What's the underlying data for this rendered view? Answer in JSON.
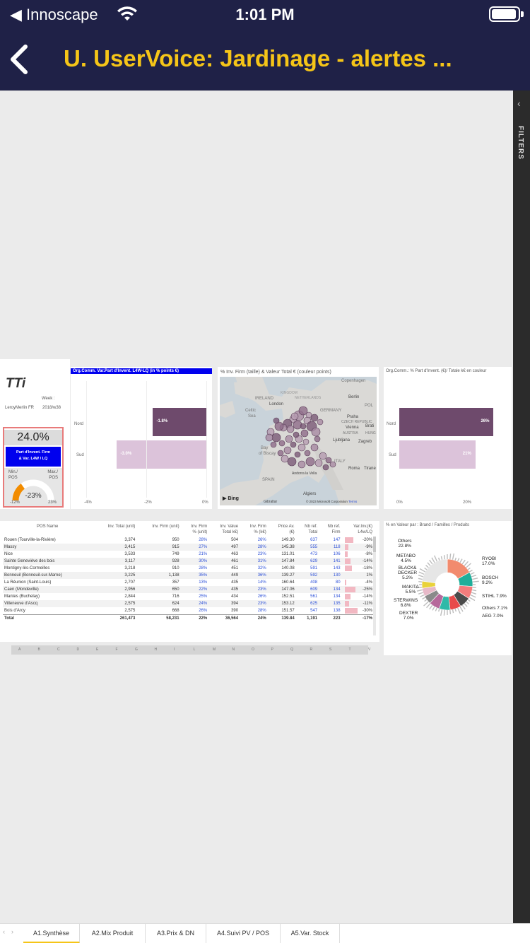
{
  "status": {
    "back_app": "◀ Innoscape",
    "time": "1:01 PM"
  },
  "nav": {
    "title": "U. UserVoice: Jardinage - alertes ..."
  },
  "filters": {
    "label": "FILTERS"
  },
  "logo_card": {
    "logo": "TTi",
    "week_label": "Week :",
    "store": "LeroyMerlin FR",
    "week": "2018/w38"
  },
  "kpi": {
    "value": "24.0%",
    "subtitle_1": "Part d'Invent. Firm",
    "subtitle_2": "& Var. L4W / LQ",
    "min_label": "Min./",
    "min_label2": "POS",
    "max_label": "Max./",
    "max_label2": "POS",
    "gauge_value": "-23%",
    "gauge_min": "-12%",
    "gauge_max": "23%",
    "gauge_fraction": 0.3
  },
  "chart_var": {
    "title": "Org.Comm. Var.Part d'Invent. L4W-LQ (in % points €)",
    "chart_data": {
      "type": "bar",
      "categories": [
        "Nord",
        "Sud"
      ],
      "values": [
        -1.8,
        -3.0
      ],
      "labels": [
        "-1.8%",
        "-3.0%"
      ],
      "x_ticks": [
        "-4%",
        "-2%",
        "0%"
      ],
      "xlim": [
        -4,
        0
      ]
    }
  },
  "map": {
    "title": "% Inv. Firm (taille) & Valeur Total € (couleur points)",
    "labels": [
      "Copenhagen",
      "IRELAND",
      "KINGDOM",
      "London",
      "NETHERLANDS",
      "GERMANY",
      "Berlin",
      "POL",
      "Celtic",
      "Sea",
      "Praha",
      "CZECH REPUBLIC",
      "Vienna",
      "Brati",
      "AUSTRIA",
      "HUNG",
      "Ljubljana",
      "Zagreb",
      "Bay",
      "of Biscay",
      "ITALY",
      "Roma",
      "Tirane",
      "SPAIN",
      "Andorra la Vella",
      "Gibraltar",
      "Algiers"
    ],
    "bing": "Bing",
    "copyright": "© 2023 Microsoft Corporation",
    "terms": "Terms"
  },
  "chart_share": {
    "title": "Org.Comm.: % Part d'Invent. (€)/ Totale k€ en couleur",
    "chart_data": {
      "type": "bar",
      "categories": [
        "Nord",
        "Sud"
      ],
      "values": [
        26,
        21
      ],
      "labels": [
        "26%",
        "21%"
      ],
      "x_ticks": [
        "0%",
        "20%"
      ],
      "xlim": [
        0,
        30
      ]
    }
  },
  "table": {
    "headers": [
      [
        "POS Name",
        ""
      ],
      [
        "Inv. Total (unit)",
        ""
      ],
      [
        "Inv. Firm (unit)",
        ""
      ],
      [
        "Inv. Firm",
        "% (unit)"
      ],
      [
        "Inv. Value",
        "Total k€)"
      ],
      [
        "Inv. Firm",
        "% (k€)"
      ],
      [
        "Price Av.",
        "(€)"
      ],
      [
        "Nb ref.",
        "Total"
      ],
      [
        "Nb ref.",
        "Firm"
      ],
      [
        "Var.Inv.(€)",
        "L4w/LQ"
      ]
    ],
    "rows": [
      [
        "Rouen (Tourville-la-Rivière)",
        "3,374",
        "950",
        "28%",
        "504",
        "26%",
        "149.30",
        "637",
        "147",
        "-20%"
      ],
      [
        "Massy",
        "3,415",
        "915",
        "27%",
        "497",
        "28%",
        "145.38",
        "555",
        "118",
        "-9%"
      ],
      [
        "Nice",
        "3,533",
        "749",
        "21%",
        "463",
        "23%",
        "131.01",
        "473",
        "106",
        "-8%"
      ],
      [
        "Sainte Geneviève des bois",
        "3,117",
        "928",
        "30%",
        "461",
        "31%",
        "147.84",
        "629",
        "141",
        "-14%"
      ],
      [
        "Montigny-lès-Cormeilles",
        "3,218",
        "910",
        "28%",
        "451",
        "32%",
        "140.08",
        "591",
        "143",
        "-18%"
      ],
      [
        "Bonneuil (Bonneuil-sur-Marne)",
        "3,225",
        "1,138",
        "35%",
        "449",
        "36%",
        "139.27",
        "592",
        "130",
        "1%"
      ],
      [
        "La Réunion (Saint-Louis)",
        "2,707",
        "357",
        "13%",
        "435",
        "14%",
        "160.64",
        "408",
        "80",
        "-4%"
      ],
      [
        "Caen (Mondeville)",
        "2,956",
        "650",
        "22%",
        "435",
        "23%",
        "147.06",
        "609",
        "134",
        "-25%"
      ],
      [
        "Mantes (Buchelay)",
        "2,844",
        "716",
        "25%",
        "434",
        "26%",
        "152.51",
        "561",
        "134",
        "-14%"
      ],
      [
        "Villeneuve d'Ascq",
        "2,575",
        "624",
        "24%",
        "394",
        "23%",
        "153.12",
        "625",
        "135",
        "-11%"
      ],
      [
        "Bois d'Arcy",
        "2,575",
        "668",
        "26%",
        "390",
        "28%",
        "151.57",
        "547",
        "138",
        "-30%"
      ]
    ],
    "total": [
      "Total",
      "261,473",
      "58,231",
      "22%",
      "36,564",
      "24%",
      "139.84",
      "1,191",
      "223",
      "-17%"
    ],
    "letters": [
      "A",
      "B",
      "C",
      "D",
      "E",
      "F",
      "G",
      "H",
      "I",
      "L",
      "M",
      "N",
      "O",
      "P",
      "Q",
      "R",
      "S",
      "T",
      "V"
    ]
  },
  "donut": {
    "title": "% en Valeur par : Brand / Familles / Produits",
    "chart_data": {
      "type": "pie",
      "slices": [
        {
          "name": "RYOBI",
          "value": 17.0
        },
        {
          "name": "BOSCH",
          "value": 9.2
        },
        {
          "name": "STIHL",
          "value": 7.9
        },
        {
          "name": "Others",
          "value": 7.1
        },
        {
          "name": "AEG",
          "value": 7.0
        },
        {
          "name": "DEXTER",
          "value": 7.0
        },
        {
          "name": "STERWINS",
          "value": 6.8
        },
        {
          "name": "MAKITA",
          "value": 5.5
        },
        {
          "name": "BLACK& DECKER",
          "value": 5.2
        },
        {
          "name": "METABO",
          "value": 4.5
        },
        {
          "name": "Others",
          "value": 22.8
        }
      ]
    },
    "labels": {
      "others_top": "Others",
      "others_top_v": "22.8%",
      "metabo": "METABO",
      "metabo_v": "4.5%",
      "black": "BLACK&",
      "black2": "DECKER",
      "black_v": "5.2%",
      "makita": "MAKITA",
      "makita_v": "5.5%",
      "sterwins": "STERWINS",
      "sterwins_v": "6.8%",
      "dexter": "DEXTER",
      "dexter_v": "7.0%",
      "ryobi": "RYOBI",
      "ryobi_v": "17.0%",
      "bosch": "BOSCH",
      "bosch_v": "9.2%",
      "stihl": "STIHL 7.9%",
      "others_r": "Others 7.1%",
      "aeg": "AEG 7.0%"
    }
  },
  "tabs": [
    "A1.Synthèse",
    "A2.Mix Produit",
    "A3.Prix & DN",
    "A4.Suivi PV / POS",
    "A5.Var. Stock"
  ],
  "colors": {
    "nav_bg": "#1f2147",
    "title_yellow": "#f5c518",
    "bar_dark": "#6e4a6c",
    "bar_light": "#dcc3da"
  }
}
